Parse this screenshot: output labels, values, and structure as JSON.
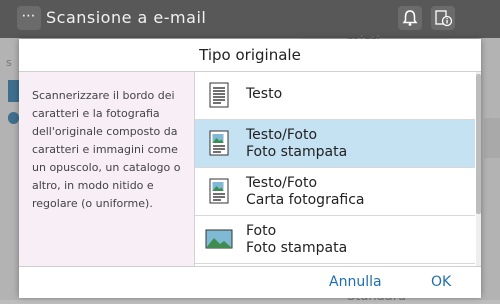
{
  "app": {
    "title": "Scansione a e-mail",
    "menu_glyph": "⋯",
    "icons": [
      "bell-icon",
      "help-info-icon"
    ],
    "background_fragments": [
      "misti",
      "Standard",
      "s"
    ]
  },
  "dialog": {
    "title": "Tipo originale",
    "description": "Scannerizzare il bordo dei caratteri e la fotografia dell'originale composto da caratteri e immagini come un opuscolo, un catalogo o altro, in modo nitido e regolare (o uniforme).",
    "options": [
      {
        "line1": "Testo",
        "line2": "",
        "icon": "text-document-icon",
        "selected": false
      },
      {
        "line1": "Testo/Foto",
        "line2": "Foto stampata",
        "icon": "text-photo-document-icon",
        "selected": true
      },
      {
        "line1": "Testo/Foto",
        "line2": "Carta fotografica",
        "icon": "text-photo-document-icon",
        "selected": false
      },
      {
        "line1": "Foto",
        "line2": "Foto stampata",
        "icon": "photo-icon",
        "selected": false
      }
    ],
    "cancel_label": "Annulla",
    "ok_label": "OK"
  },
  "colors": {
    "topbar": "#585858",
    "selected_row": "#c5e2f3",
    "description_bg": "#f7eef6",
    "button_text": "#1f6fae"
  }
}
